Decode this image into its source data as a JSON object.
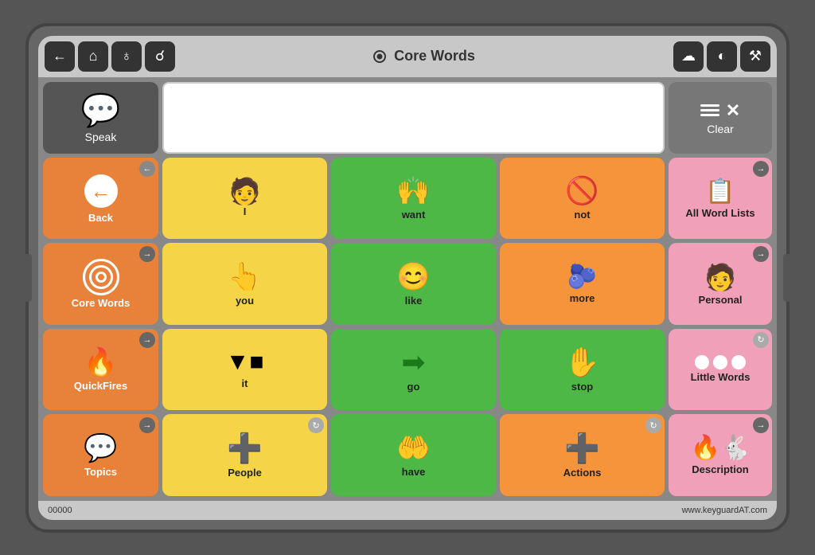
{
  "app": {
    "title": "Core Words",
    "serial": "00000",
    "website": "www.keyguardAT.com"
  },
  "topbar": {
    "left_icons": [
      "back-icon",
      "home-icon",
      "globe-icon",
      "search-icon"
    ],
    "right_icons": [
      "cloud-icon",
      "moon-icon",
      "tools-icon"
    ]
  },
  "speak_button": {
    "label": "Speak"
  },
  "clear_button": {
    "label": "Clear"
  },
  "nav_column": [
    {
      "id": "back",
      "label": "Back",
      "icon": "back-arrow-icon"
    },
    {
      "id": "core-words",
      "label": "Core Words",
      "icon": "target-icon"
    },
    {
      "id": "quickfires",
      "label": "QuickFires",
      "icon": "fire-icon"
    },
    {
      "id": "topics",
      "label": "Topics",
      "icon": "chat-icon"
    }
  ],
  "word_grid": [
    [
      {
        "id": "I",
        "label": "I",
        "color": "yellow",
        "icon": "person-pointing-icon"
      },
      {
        "id": "want",
        "label": "want",
        "color": "green",
        "icon": "hands-reaching-icon"
      },
      {
        "id": "not",
        "label": "not",
        "color": "orange",
        "icon": "no-symbol-icon"
      }
    ],
    [
      {
        "id": "you",
        "label": "you",
        "color": "yellow",
        "icon": "pointing-icon"
      },
      {
        "id": "like",
        "label": "like",
        "color": "green",
        "icon": "smiley-icon"
      },
      {
        "id": "more",
        "label": "more",
        "color": "orange",
        "icon": "dots-icon"
      }
    ],
    [
      {
        "id": "it",
        "label": "it",
        "color": "yellow",
        "icon": "box-icon"
      },
      {
        "id": "go",
        "label": "go",
        "color": "green",
        "icon": "arrow-right-icon"
      },
      {
        "id": "stop",
        "label": "stop",
        "color": "green",
        "icon": "stop-hand-icon"
      }
    ],
    [
      {
        "id": "people",
        "label": "People",
        "color": "yellow",
        "icon": "plus-icon"
      },
      {
        "id": "have",
        "label": "have",
        "color": "green",
        "icon": "hand-holding-icon"
      },
      {
        "id": "actions",
        "label": "Actions",
        "color": "orange",
        "icon": "plus-icon"
      }
    ]
  ],
  "side_column": [
    {
      "id": "all-word-lists",
      "label": "All Word Lists",
      "icon": "list-icon",
      "color": "pink"
    },
    {
      "id": "personal",
      "label": "Personal",
      "icon": "personal-icon",
      "color": "pink"
    },
    {
      "id": "little-words",
      "label": "Little Words",
      "icon": "circles-icon",
      "color": "pink"
    },
    {
      "id": "description",
      "label": "Description",
      "icon": "fire-scene-icon",
      "color": "pink"
    }
  ]
}
